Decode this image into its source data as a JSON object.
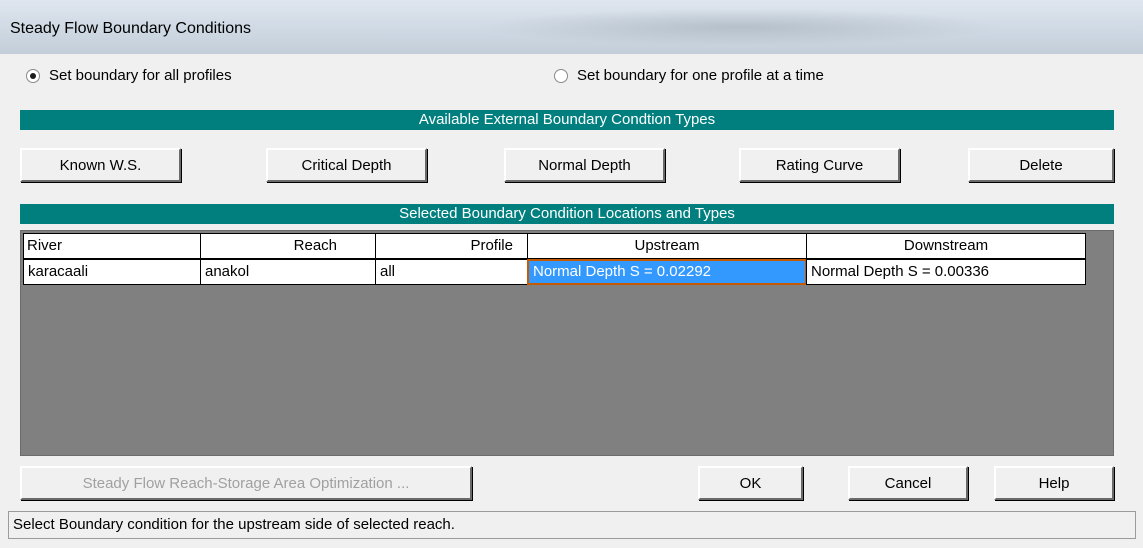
{
  "window": {
    "title": "Steady Flow Boundary Conditions"
  },
  "options": {
    "all_profiles_label": "Set boundary for all profiles",
    "one_profile_label": "Set boundary for one profile at a time",
    "selected": "all_profiles"
  },
  "available_types": {
    "header": "Available External Boundary Condtion Types",
    "buttons": {
      "known_ws": "Known W.S.",
      "critical_depth": "Critical Depth",
      "normal_depth": "Normal Depth",
      "rating_curve": "Rating Curve",
      "delete": "Delete"
    }
  },
  "locations": {
    "header": "Selected Boundary Condition Locations and Types",
    "columns": [
      "River",
      "Reach",
      "Profile",
      "Upstream",
      "Downstream"
    ],
    "rows": [
      {
        "river": "karacaali",
        "reach": "anakol",
        "profile": "all",
        "upstream": "Normal Depth S = 0.02292",
        "downstream": "Normal Depth S = 0.00336"
      }
    ],
    "selected_cell": "upstream"
  },
  "footer": {
    "optimization_label": "Steady Flow Reach-Storage Area Optimization ...",
    "ok_label": "OK",
    "cancel_label": "Cancel",
    "help_label": "Help"
  },
  "status_text": "Select Boundary condition for the upstream side of selected reach.",
  "colors": {
    "header_bar": "#017f7f",
    "selection": "#3399ff",
    "selection_border": "#c65a00",
    "grid_background": "#808080"
  }
}
